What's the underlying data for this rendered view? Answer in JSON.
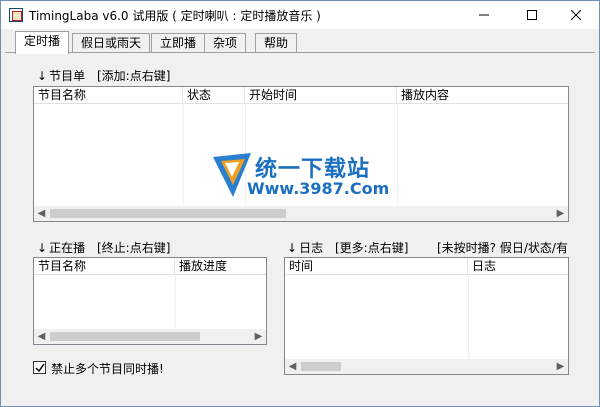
{
  "window": {
    "title": "TimingLaba v6.0 试用版  ( 定时喇叭 : 定时播放音乐 )",
    "border_color": "#6f8fb7"
  },
  "tabs": [
    {
      "label": "定时播",
      "active": true
    },
    {
      "label": "假日或雨天",
      "active": false
    },
    {
      "label": "立即播",
      "active": false
    },
    {
      "label": "杂项",
      "active": false
    },
    {
      "label": "帮助",
      "active": false
    }
  ],
  "program_list": {
    "heading": "节目单",
    "hint": "[添加:点右键]",
    "columns": [
      "节目名称",
      "状态",
      "开始时间",
      "播放内容"
    ]
  },
  "now_playing": {
    "heading": "正在播",
    "hint": "[终止:点右键]",
    "columns": [
      "节目名称",
      "播放进度"
    ]
  },
  "log": {
    "heading": "日志",
    "hint": "[更多:点右键]",
    "extra_hint": "[未按时播? 假日/状态/有",
    "columns": [
      "时间",
      "日志"
    ]
  },
  "options": {
    "no_multi_play_label": "禁止多个节目同时播!",
    "no_multi_play_checked": true
  },
  "watermark": {
    "line1": "统一下载站",
    "line2": "Www.3987.Com"
  },
  "icons": {
    "minimize": "minimize-icon",
    "maximize": "maximize-icon",
    "close": "close-icon",
    "arrow_down": "arrow-down-icon",
    "scroll_left": "scroll-left-icon",
    "scroll_right": "scroll-right-icon"
  }
}
